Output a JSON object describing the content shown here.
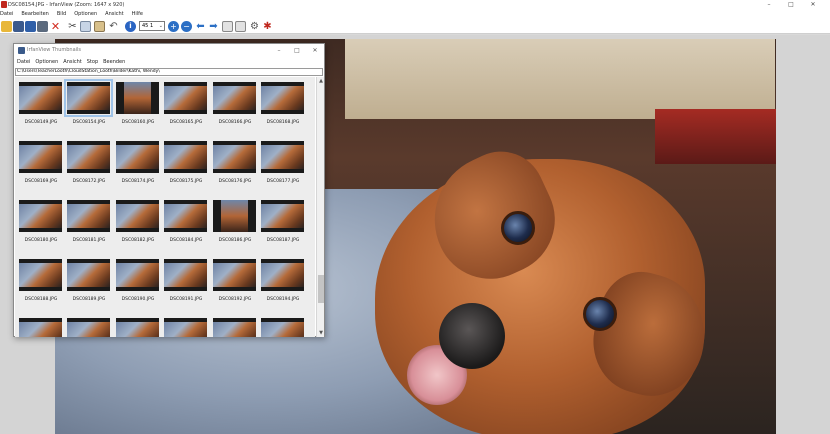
{
  "window": {
    "title": "DSC08154.JPG - IrfanView (Zoom: 1647 x 920)",
    "controls": {
      "minimize": "–",
      "maximize": "□",
      "close": "✕"
    }
  },
  "menubar": {
    "items": [
      "Datei",
      "Bearbeiten",
      "Bild",
      "Optionen",
      "Ansicht",
      "Hilfe"
    ]
  },
  "toolbar": {
    "zoom_value": "45 1",
    "icons": [
      "open-icon",
      "thumbnails-icon",
      "save-icon",
      "print-icon",
      "delete-icon",
      "cut-icon",
      "copy-icon",
      "paste-icon",
      "undo-icon",
      "info-icon",
      "zoom-in-icon",
      "zoom-out-icon",
      "previous-icon",
      "next-icon",
      "first-page-icon",
      "last-page-icon",
      "settings-icon",
      "irfanview-icon"
    ]
  },
  "thumbnails": {
    "title": "IrfanView Thumbnails",
    "menu": [
      "Datei",
      "Optionen",
      "Ansicht",
      "Stop",
      "Beenden"
    ],
    "path": "C:\\Users\\TeacherLooth\\CloudStation_Looth\\Bilder\\Kathi, Wendy\\",
    "selected_index": 1,
    "rows": [
      [
        "DSC08149.JPG",
        "DSC08154.JPG",
        "DSC08160.JPG",
        "DSC08165.JPG",
        "DSC08166.JPG",
        "DSC08168.JPG"
      ],
      [
        "DSC08169.JPG",
        "DSC08172.JPG",
        "DSC08174.JPG",
        "DSC08175.JPG",
        "DSC08176.JPG",
        "DSC08177.JPG"
      ],
      [
        "DSC08180.JPG",
        "DSC08181.JPG",
        "DSC08182.JPG",
        "DSC08184.JPG",
        "DSC08186.JPG",
        "DSC08187.JPG"
      ],
      [
        "DSC08188.JPG",
        "DSC08189.JPG",
        "DSC08190.JPG",
        "DSC08191.JPG",
        "DSC08192.JPG",
        "DSC08194.JPG"
      ],
      [
        "",
        "",
        "",
        "",
        "",
        ""
      ]
    ],
    "tall_cells": [
      "DSC08160.JPG",
      "DSC08186.JPG"
    ]
  },
  "colors": {
    "titlebar_bg": "#ffffff",
    "canvas_bg": "#d4d4d4",
    "selection": "#9fc3e8",
    "app_icon": "#c0281e"
  }
}
